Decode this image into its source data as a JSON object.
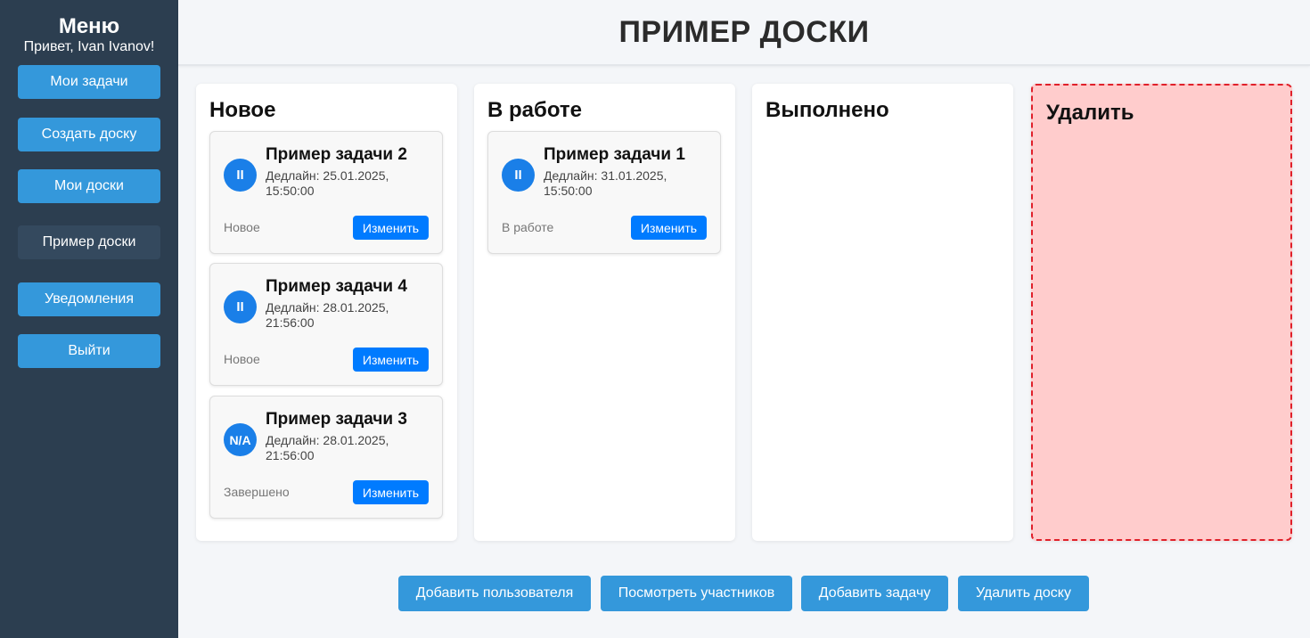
{
  "sidebar": {
    "title": "Меню",
    "greeting": "Привет, Ivan Ivanov!",
    "items": [
      {
        "label": "Мои задачи"
      },
      {
        "label": "Создать доску"
      },
      {
        "label": "Мои доски"
      },
      {
        "label": "Пример доски",
        "active": true
      },
      {
        "label": "Уведомления"
      },
      {
        "label": "Выйти"
      }
    ]
  },
  "header": {
    "title": "ПРИМЕР ДОСКИ"
  },
  "columns": [
    {
      "title": "Новое",
      "cards": [
        {
          "badge": "II",
          "title": "Пример задачи 2",
          "deadline": "Дедлайн: 25.01.2025, 15:50:00",
          "status": "Новое",
          "edit_label": "Изменить"
        },
        {
          "badge": "II",
          "title": "Пример задачи 4",
          "deadline": "Дедлайн: 28.01.2025, 21:56:00",
          "status": "Новое",
          "edit_label": "Изменить"
        },
        {
          "badge": "N/A",
          "title": "Пример задачи 3",
          "deadline": "Дедлайн: 28.01.2025, 21:56:00",
          "status": "Завершено",
          "edit_label": "Изменить"
        }
      ]
    },
    {
      "title": "В работе",
      "cards": [
        {
          "badge": "II",
          "title": "Пример задачи 1",
          "deadline": "Дедлайн: 31.01.2025, 15:50:00",
          "status": "В работе",
          "edit_label": "Изменить"
        }
      ]
    },
    {
      "title": "Выполнено",
      "cards": []
    },
    {
      "title": "Удалить",
      "cards": []
    }
  ],
  "actions": [
    {
      "label": "Добавить пользователя"
    },
    {
      "label": "Посмотреть участников"
    },
    {
      "label": "Добавить задачу"
    },
    {
      "label": "Удалить доску"
    }
  ],
  "colors": {
    "sidebar_bg": "#2c3e50",
    "nav_button": "#3498db",
    "nav_active": "#34495e",
    "badge": "#1a7fe8",
    "edit_button": "#007bff",
    "delete_zone_bg": "#ffcccc",
    "delete_zone_border": "#e0202a"
  }
}
